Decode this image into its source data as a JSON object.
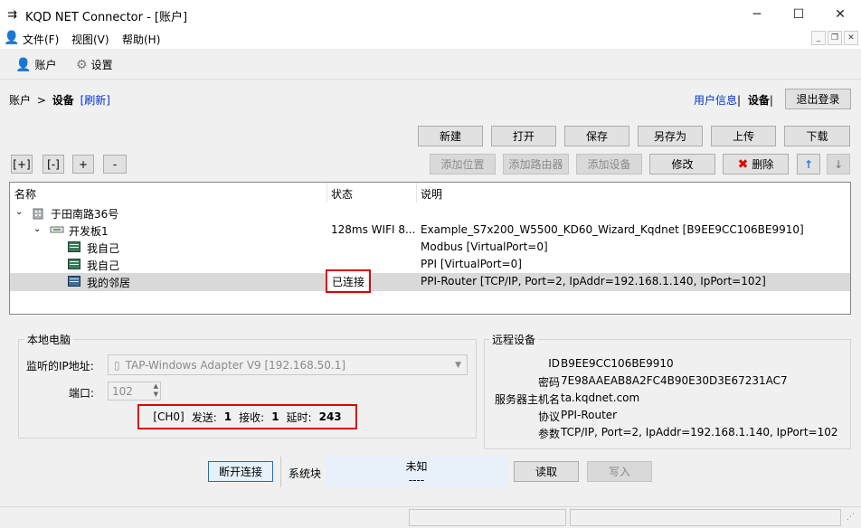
{
  "window": {
    "title": "KQD NET Connector - [账户]",
    "app_icon": "kqd-logo-icon"
  },
  "menu": {
    "items": [
      "文件(F)",
      "视图(V)",
      "帮助(H)"
    ]
  },
  "toolbar": {
    "account_label": "账户",
    "settings_label": "设置"
  },
  "breadcrumb": {
    "root": "账户",
    "sep": ">",
    "current": "设备",
    "refresh": "[刷新]"
  },
  "user_nav": {
    "user_info": "用户信息",
    "sep1": "|",
    "devices": "设备",
    "sep2": "|",
    "logout": "退出登录"
  },
  "file_buttons": {
    "new": "新建",
    "open": "打开",
    "save": "保存",
    "save_as": "另存为",
    "upload": "上传",
    "download": "下载"
  },
  "tree_buttons": {
    "expand": "[+]",
    "collapse": "[-]",
    "plus": "+",
    "minus": "-"
  },
  "edit_buttons": {
    "add_location": "添加位置",
    "add_router": "添加路由器",
    "add_device": "添加设备",
    "modify": "修改",
    "delete": "删除",
    "up": "↑",
    "down": "↓"
  },
  "tree": {
    "columns": {
      "name": "名称",
      "status": "状态",
      "desc": "说明"
    },
    "rows": [
      {
        "name": "于田南路36号",
        "status": "",
        "desc": ""
      },
      {
        "name": "开发板1",
        "status": "128ms WIFI 8...",
        "desc": "Example_S7x200_W5500_KD60_Wizard_Kqdnet [B9EE9CC106BE9910]"
      },
      {
        "name": "我自己",
        "status": "",
        "desc": "Modbus [VirtualPort=0]"
      },
      {
        "name": "我自己",
        "status": "",
        "desc": "PPI [VirtualPort=0]"
      },
      {
        "name": "我的邻居",
        "status": "已连接",
        "desc": "PPI-Router [TCP/IP, Port=2, IpAddr=192.168.1.140, IpPort=102]"
      }
    ]
  },
  "local_pc": {
    "title": "本地电脑",
    "ip_label": "监听的IP地址:",
    "ip_value": "TAP-Windows Adapter V9 [192.168.50.1]",
    "port_label": "端口:",
    "port_value": "102",
    "stats": {
      "channel": "[CH0]",
      "send_label": "发送:",
      "send_value": "1",
      "recv_label": "接收:",
      "recv_value": "1",
      "delay_label": "延时:",
      "delay_value": "243"
    }
  },
  "remote": {
    "title": "远程设备",
    "fields": [
      {
        "label": "ID",
        "value": "B9EE9CC106BE9910"
      },
      {
        "label": "密码",
        "value": "7E98AAEAB8A2FC4B90E30D3E67231AC7"
      },
      {
        "label": "服务器主机名",
        "value": "ta.kqdnet.com"
      },
      {
        "label": "协议",
        "value": "PPI-Router"
      },
      {
        "label": "参数",
        "value": "TCP/IP, Port=2, IpAddr=192.168.1.140, IpPort=102"
      }
    ]
  },
  "bottom": {
    "disconnect": "断开连接",
    "sysblock_label": "系统块",
    "sysblock_value": "未知",
    "sysblock_sub": "----",
    "read": "读取",
    "write": "写入"
  },
  "colors": {
    "highlight_red": "#e00000",
    "link_blue": "#0033cc",
    "selected_row": "#d9d9d9",
    "sysblock_bg": "#e8f0fa"
  }
}
